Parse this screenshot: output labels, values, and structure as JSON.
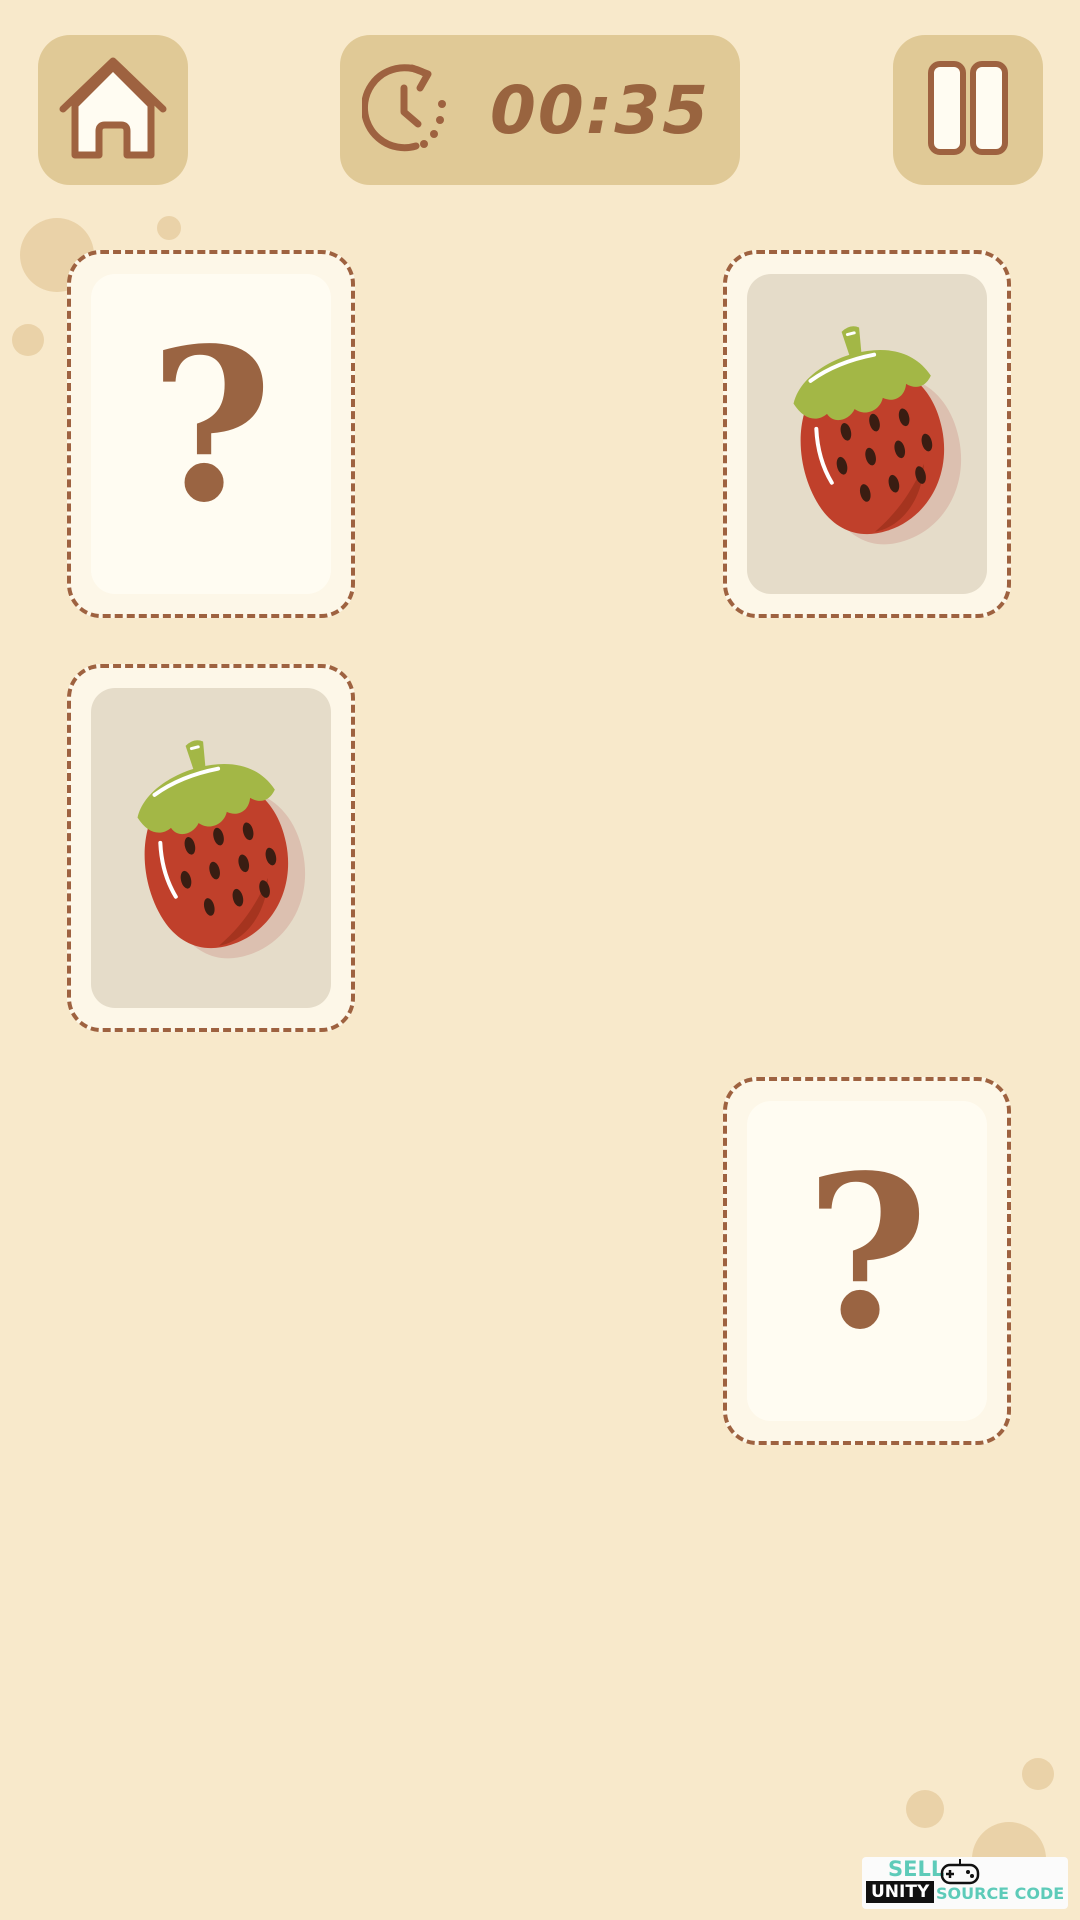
{
  "top_bar": {
    "home_icon": "home-icon",
    "timer": {
      "icon": "clock-timer-icon",
      "value": "00:35"
    },
    "pause_icon": "pause-icon"
  },
  "board": {
    "cards": [
      {
        "state": "hidden",
        "content": "?"
      },
      {
        "state": "revealed",
        "content": "strawberry-icon"
      },
      {
        "state": "revealed",
        "content": "strawberry-icon"
      },
      {
        "state": "hidden",
        "content": "?"
      }
    ]
  },
  "watermark": {
    "line1": "SELL",
    "line2": "UNITY",
    "line3": "SOURCE CODE"
  },
  "colors": {
    "background": "#f8e9cb",
    "button": "#e0c996",
    "brown": "#9a6442",
    "strawberry_red": "#c0402b",
    "leaf_green": "#a3b746"
  }
}
